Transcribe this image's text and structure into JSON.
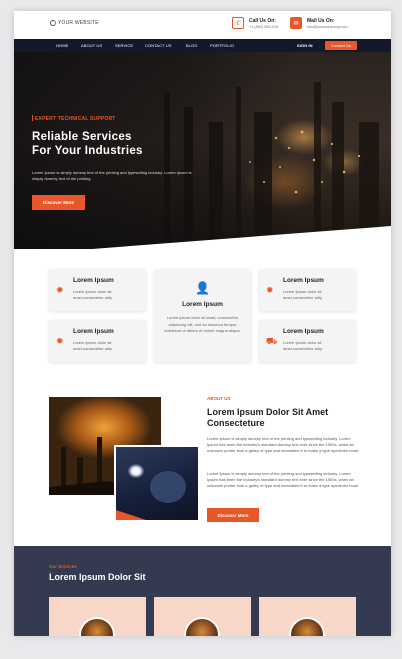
{
  "header": {
    "logo_text": "YOUR WEBSITE",
    "call": {
      "label": "Call Us On:",
      "value": "+1 (852) 555-018"
    },
    "mail": {
      "label": "Mail Us On:",
      "value": "info@yourcompany.com"
    }
  },
  "nav": {
    "items": [
      "HOME",
      "ABOUT US",
      "SERVICE",
      "CONTACT US",
      "BLOG",
      "PORTFOLIO"
    ],
    "sign_in": "SIGN IN",
    "cta": "Contact Us"
  },
  "hero": {
    "tag": "EXPERT TECHNICAL SUPPORT",
    "title_line1": "Reliable Services",
    "title_line2": "For Your Industries",
    "text": "Lorem Ipsum is simply dummy text of the printing and typesetting industry. Lorem Ipsum is simply dummy text of the printing",
    "button": "Discover More"
  },
  "features": [
    {
      "title": "Lorem Ipsum",
      "text": "Lorem Ipsum dolor sit amet,consectetur adip",
      "icon": "gear-icon"
    },
    {
      "title": "Lorem Ipsum",
      "text": "Lorem Ipsum dolor sit amet,consectetur adip",
      "icon": "gear-icon"
    },
    {
      "title": "Lorem Ipsum",
      "text": "Lorem Ipsum dolor sit amet, consectetur adipiscing elit, sed do eiusmod tempor incididunt ut labore et dolore magna aliqua.",
      "icon": "user-icon"
    },
    {
      "title": "Lorem Ipsum",
      "text": "Lorem Ipsum dolor sit amet,consectetur adip",
      "icon": "gear-icon"
    },
    {
      "title": "Lorem Ipsum",
      "text": "Lorem Ipsum dolor sit amet,consectetur adip",
      "icon": "truck-icon"
    }
  ],
  "about": {
    "tag": "ABOUT US",
    "title_line1": "Lorem Ipsum Dolor Sit Amet",
    "title_line2": "Consecteture",
    "p1": "Lorem Ipsum is simply dummy text of the printing and typesetting industry. Lorem Ipsum has been the industry's standard dummy text ever since the 1500s, when an unknown printer took a galley of type and scrambled it to make a type specimen book.",
    "p2": "Lorem Ipsum is simply dummy text of the printing and typesetting industry. Lorem Ipsum has been the industry's standard dummy text ever since the 1500s, when an unknown printer took a galley of type and scrambled it to make a type specimen book.",
    "button": "Discover More"
  },
  "services": {
    "tag": "Our Services",
    "title": "Lorem Ipsum Dolor Sit"
  },
  "colors": {
    "accent": "#e8572a",
    "nav_bg": "#14182b",
    "services_bg": "#343a4f"
  }
}
